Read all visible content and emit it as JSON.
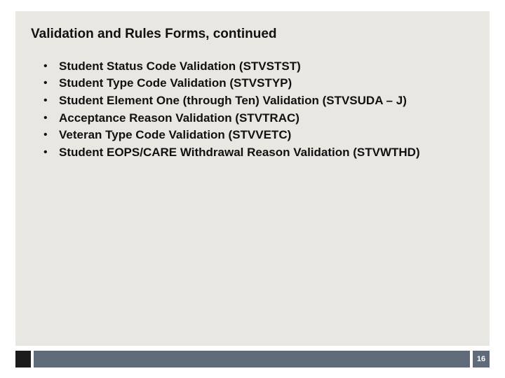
{
  "title": "Validation and Rules Forms, continued",
  "bullets": [
    "Student Status Code Validation (STVSTST)",
    "Student Type Code Validation (STVSTYP)",
    "Student Element One (through Ten) Validation (STVSUDA – J)",
    "Acceptance Reason Validation (STVTRAC)",
    "Veteran Type Code Validation (STVVETC)",
    "Student EOPS/CARE Withdrawal Reason Validation (STVWTHD)"
  ],
  "page_number": "16"
}
